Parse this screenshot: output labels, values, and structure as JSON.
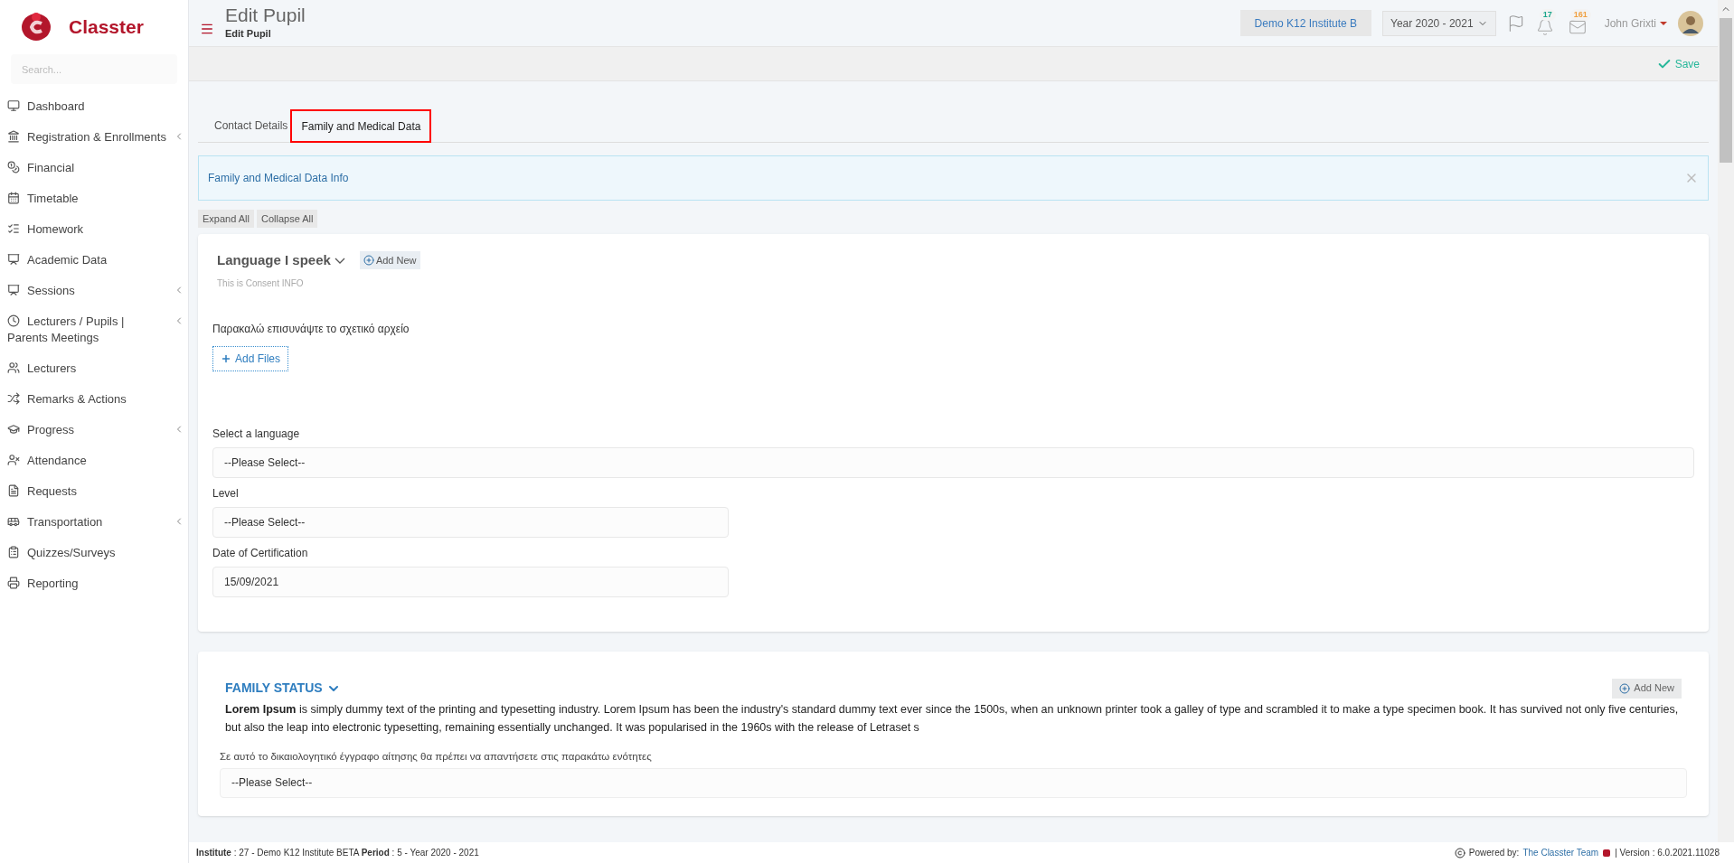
{
  "brand": {
    "name": "Classter"
  },
  "sidebar": {
    "search": {
      "placeholder": "Search..."
    },
    "items": [
      {
        "label": "Dashboard",
        "expandable": false
      },
      {
        "label": "Registration & Enrollments",
        "expandable": true
      },
      {
        "label": "Financial",
        "expandable": false
      },
      {
        "label": "Timetable",
        "expandable": false
      },
      {
        "label": "Homework",
        "expandable": false
      },
      {
        "label": "Academic Data",
        "expandable": false
      },
      {
        "label": "Sessions",
        "expandable": true
      },
      {
        "label": "Lecturers / Pupils | Parents Meetings",
        "expandable": true
      },
      {
        "label": "Lecturers",
        "expandable": false
      },
      {
        "label": "Remarks & Actions",
        "expandable": false
      },
      {
        "label": "Progress",
        "expandable": true
      },
      {
        "label": "Attendance",
        "expandable": false
      },
      {
        "label": "Requests",
        "expandable": false
      },
      {
        "label": "Transportation",
        "expandable": true
      },
      {
        "label": "Quizzes/Surveys",
        "expandable": false
      },
      {
        "label": "Reporting",
        "expandable": false
      }
    ]
  },
  "header": {
    "title": "Edit Pupil",
    "breadcrumb": "Edit Pupil",
    "institute": "Demo K12 Institute B",
    "year": "Year 2020 - 2021",
    "notifications": "17",
    "messages": "161",
    "user": "John Grixti"
  },
  "toolbar": {
    "save": "Save"
  },
  "tabs": [
    {
      "label": "Contact Details",
      "selected": false
    },
    {
      "label": "Family and Medical Data",
      "selected": true
    }
  ],
  "info": {
    "text": "Family and Medical Data Info"
  },
  "actions": [
    "Expand All",
    "Collapse All"
  ],
  "language_section": {
    "title": "Language I speek",
    "add": "Add New",
    "subtitle": "This is Consent INFO",
    "attach_label": "Παρακαλώ επισυνάψτε το σχετικό αρχείο",
    "add_files": "Add Files",
    "fields": [
      {
        "label": "Select a language",
        "value": "--Please Select--",
        "wide": true
      },
      {
        "label": "Level",
        "value": "--Please Select--",
        "wide": false
      },
      {
        "label": "Date of Certification",
        "value": "15/09/2021",
        "wide": false
      }
    ]
  },
  "family_section": {
    "title": "FAMILY STATUS",
    "add": "Add New",
    "text": "**Lorem Ipsum** is simply dummy text of the printing and typesetting industry. Lorem Ipsum has been the industry's standard dummy text ever since the 1500s, when an unknown printer took a galley of type and scrambled it to make a type specimen book. It has survived not only five centuries, but also the leap into electronic typesetting, remaining essentially unchanged. It was popularised in the 1960s with the release of Letraset s",
    "question": "Σε αυτό το δικαιολογητικό έγγραφο αίτησης θα πρέπει να απαντήσετε στις παρακάτω ενότητες",
    "value": "--Please Select--"
  },
  "status_bar": {
    "info": "**Institute** : 27 - Demo K12 Institute BETA **Period** : 5 - Year 2020 - 2021",
    "powered": "Powered by:",
    "team": "The Classter Team",
    "version": "| Version : 6.0.2021.11028"
  }
}
